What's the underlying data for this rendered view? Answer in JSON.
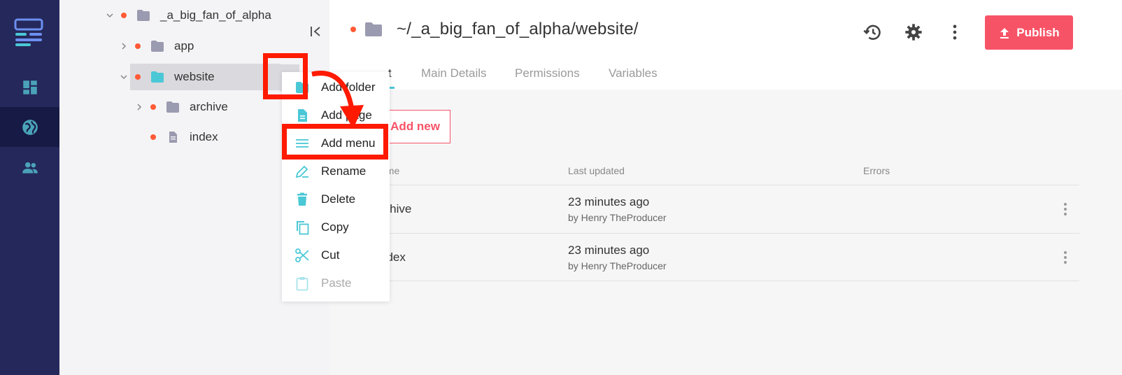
{
  "rail": {
    "items": [
      {
        "icon": "logo-icon"
      },
      {
        "icon": "dashboard-icon"
      },
      {
        "icon": "globe-icon"
      },
      {
        "icon": "people-icon"
      }
    ]
  },
  "tree": {
    "root": "_a_big_fan_of_alpha",
    "items": [
      {
        "label": "app"
      },
      {
        "label": "website"
      },
      {
        "label": "archive"
      },
      {
        "label": "index"
      }
    ]
  },
  "header": {
    "path": "~/_a_big_fan_of_alpha/website/",
    "publish_label": "Publish"
  },
  "tabs": [
    {
      "label": "t"
    },
    {
      "label": "Main Details"
    },
    {
      "label": "Permissions"
    },
    {
      "label": "Variables"
    }
  ],
  "add_new_label": "Add new",
  "table": {
    "headers": [
      "ame",
      "Last updated",
      "Errors"
    ],
    "rows": [
      {
        "name": "rchive",
        "when": "23 minutes ago",
        "by": "by Henry TheProducer"
      },
      {
        "name": "ndex",
        "when": "23 minutes ago",
        "by": "by Henry TheProducer"
      }
    ]
  },
  "context_menu": {
    "items": [
      {
        "label": "Add folder"
      },
      {
        "label": "Add page"
      },
      {
        "label": "Add menu"
      },
      {
        "label": "Rename"
      },
      {
        "label": "Delete"
      },
      {
        "label": "Copy"
      },
      {
        "label": "Cut"
      },
      {
        "label": "Paste"
      }
    ]
  },
  "colors": {
    "rail": "#25285a",
    "accent": "#4bc8d6",
    "publish": "#f75367",
    "status_dot": "#ff5a36",
    "annotation": "#ff1a00"
  }
}
